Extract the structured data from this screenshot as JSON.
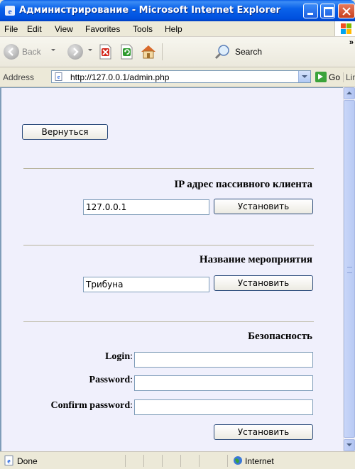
{
  "window": {
    "title": "Администрирование - Microsoft Internet Explorer"
  },
  "menu": {
    "items": [
      {
        "label": "File"
      },
      {
        "label": "Edit"
      },
      {
        "label": "View"
      },
      {
        "label": "Favorites"
      },
      {
        "label": "Tools"
      },
      {
        "label": "Help"
      }
    ]
  },
  "toolbar": {
    "back_label": "Back",
    "search_label": "Search"
  },
  "address": {
    "label": "Address",
    "url": "http://127.0.0.1/admin.php",
    "go_label": "Go",
    "links_label": "Links"
  },
  "page": {
    "back_button": "Вернуться",
    "ip_section": {
      "title": "IP адрес пассивного клиента",
      "value": "127.0.0.1",
      "button": "Установить"
    },
    "event_section": {
      "title": "Название мероприятия",
      "value": "Трибуна",
      "button": "Установить"
    },
    "security_section": {
      "title": "Безопасность",
      "login_label": "Login",
      "password_label": "Password",
      "confirm_label": "Confirm password",
      "login_value": "",
      "password_value": "",
      "confirm_value": "",
      "button": "Установить"
    }
  },
  "status": {
    "text": "Done",
    "zone": "Internet"
  }
}
